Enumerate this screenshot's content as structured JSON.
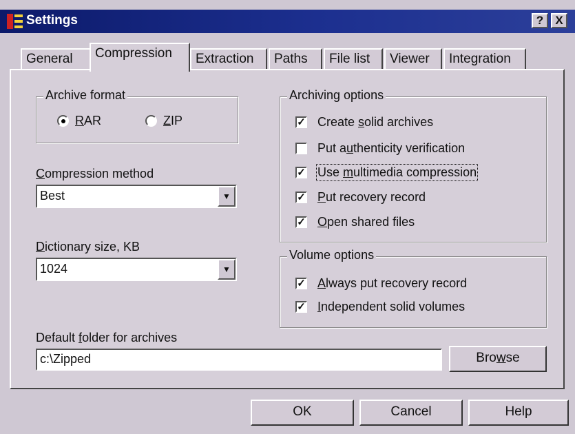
{
  "window": {
    "title": "Settings",
    "help_btn": "?",
    "close_btn": "X"
  },
  "tabs": [
    {
      "label": "General"
    },
    {
      "label": "Compression"
    },
    {
      "label": "Extraction"
    },
    {
      "label": "Paths"
    },
    {
      "label": "File list"
    },
    {
      "label": "Viewer"
    },
    {
      "label": "Integration"
    }
  ],
  "archive_format": {
    "label": "Archive format",
    "rar": {
      "pre": "",
      "u": "R",
      "post": "AR",
      "selected": true
    },
    "zip": {
      "pre": "",
      "u": "Z",
      "post": "IP",
      "selected": false
    }
  },
  "compression_method": {
    "label_u": "C",
    "label_rest": "ompression method",
    "value": "Best"
  },
  "dictionary": {
    "label_u": "D",
    "label_rest": "ictionary size, KB",
    "value": "1024"
  },
  "archiving_options": {
    "label": "Archiving options",
    "items": [
      {
        "pre": "Create ",
        "u": "s",
        "post": "olid archives",
        "checked": true,
        "mark": "✓"
      },
      {
        "pre": "Put a",
        "u": "u",
        "post": "thenticity verification",
        "checked": false,
        "mark": ""
      },
      {
        "pre": "Use ",
        "u": "m",
        "post": "ultimedia compression",
        "checked": true,
        "mark": "✓"
      },
      {
        "pre": "",
        "u": "P",
        "post": "ut recovery record",
        "checked": true,
        "mark": "✓"
      },
      {
        "pre": "",
        "u": "O",
        "post": "pen shared files",
        "checked": true,
        "mark": "✓"
      }
    ]
  },
  "volume_options": {
    "label": "Volume options",
    "items": [
      {
        "pre": "",
        "u": "A",
        "post": "lways put recovery record",
        "checked": true,
        "mark": "✓"
      },
      {
        "pre": "",
        "u": "I",
        "post": "ndependent solid volumes",
        "checked": true,
        "mark": "✓"
      }
    ]
  },
  "default_folder": {
    "label_pre": "Default ",
    "label_u": "f",
    "label_post": "older for archives",
    "value": "c:\\Zipped"
  },
  "browse": {
    "pre": "Bro",
    "u": "w",
    "post": "se"
  },
  "buttons": {
    "ok": "OK",
    "cancel": "Cancel",
    "help": "Help"
  }
}
